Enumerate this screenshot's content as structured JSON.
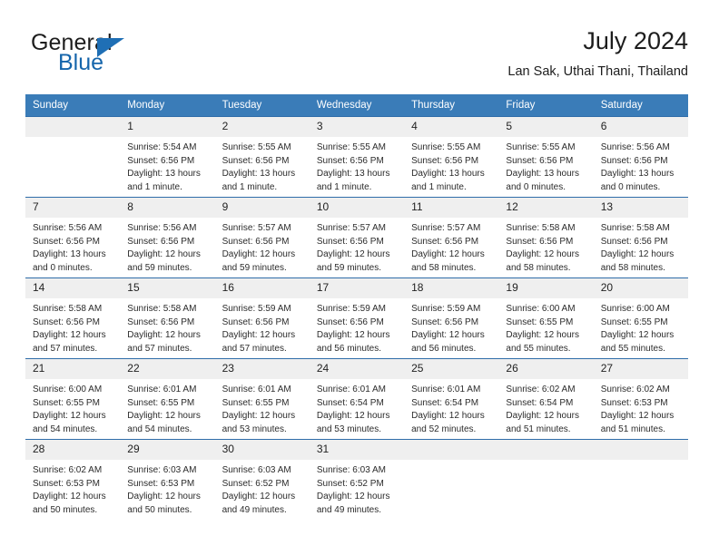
{
  "brand": {
    "name_part1": "General",
    "name_part2": "Blue",
    "triangle_icon": "triangle-icon"
  },
  "header": {
    "title": "July 2024",
    "subtitle": "Lan Sak, Uthai Thani, Thailand"
  },
  "colors": {
    "header_blue": "#3a7cb8",
    "row_border_blue": "#2f6da9",
    "daynum_band": "#efefef",
    "brand_blue": "#1565ab"
  },
  "weekday_headers": [
    "Sunday",
    "Monday",
    "Tuesday",
    "Wednesday",
    "Thursday",
    "Friday",
    "Saturday"
  ],
  "weeks": [
    [
      {
        "day": "",
        "empty": true,
        "sunrise": "",
        "sunset": "",
        "daylight1": "",
        "daylight2": ""
      },
      {
        "day": "1",
        "sunrise": "Sunrise: 5:54 AM",
        "sunset": "Sunset: 6:56 PM",
        "daylight1": "Daylight: 13 hours",
        "daylight2": "and 1 minute."
      },
      {
        "day": "2",
        "sunrise": "Sunrise: 5:55 AM",
        "sunset": "Sunset: 6:56 PM",
        "daylight1": "Daylight: 13 hours",
        "daylight2": "and 1 minute."
      },
      {
        "day": "3",
        "sunrise": "Sunrise: 5:55 AM",
        "sunset": "Sunset: 6:56 PM",
        "daylight1": "Daylight: 13 hours",
        "daylight2": "and 1 minute."
      },
      {
        "day": "4",
        "sunrise": "Sunrise: 5:55 AM",
        "sunset": "Sunset: 6:56 PM",
        "daylight1": "Daylight: 13 hours",
        "daylight2": "and 1 minute."
      },
      {
        "day": "5",
        "sunrise": "Sunrise: 5:55 AM",
        "sunset": "Sunset: 6:56 PM",
        "daylight1": "Daylight: 13 hours",
        "daylight2": "and 0 minutes."
      },
      {
        "day": "6",
        "sunrise": "Sunrise: 5:56 AM",
        "sunset": "Sunset: 6:56 PM",
        "daylight1": "Daylight: 13 hours",
        "daylight2": "and 0 minutes."
      }
    ],
    [
      {
        "day": "7",
        "sunrise": "Sunrise: 5:56 AM",
        "sunset": "Sunset: 6:56 PM",
        "daylight1": "Daylight: 13 hours",
        "daylight2": "and 0 minutes."
      },
      {
        "day": "8",
        "sunrise": "Sunrise: 5:56 AM",
        "sunset": "Sunset: 6:56 PM",
        "daylight1": "Daylight: 12 hours",
        "daylight2": "and 59 minutes."
      },
      {
        "day": "9",
        "sunrise": "Sunrise: 5:57 AM",
        "sunset": "Sunset: 6:56 PM",
        "daylight1": "Daylight: 12 hours",
        "daylight2": "and 59 minutes."
      },
      {
        "day": "10",
        "sunrise": "Sunrise: 5:57 AM",
        "sunset": "Sunset: 6:56 PM",
        "daylight1": "Daylight: 12 hours",
        "daylight2": "and 59 minutes."
      },
      {
        "day": "11",
        "sunrise": "Sunrise: 5:57 AM",
        "sunset": "Sunset: 6:56 PM",
        "daylight1": "Daylight: 12 hours",
        "daylight2": "and 58 minutes."
      },
      {
        "day": "12",
        "sunrise": "Sunrise: 5:58 AM",
        "sunset": "Sunset: 6:56 PM",
        "daylight1": "Daylight: 12 hours",
        "daylight2": "and 58 minutes."
      },
      {
        "day": "13",
        "sunrise": "Sunrise: 5:58 AM",
        "sunset": "Sunset: 6:56 PM",
        "daylight1": "Daylight: 12 hours",
        "daylight2": "and 58 minutes."
      }
    ],
    [
      {
        "day": "14",
        "sunrise": "Sunrise: 5:58 AM",
        "sunset": "Sunset: 6:56 PM",
        "daylight1": "Daylight: 12 hours",
        "daylight2": "and 57 minutes."
      },
      {
        "day": "15",
        "sunrise": "Sunrise: 5:58 AM",
        "sunset": "Sunset: 6:56 PM",
        "daylight1": "Daylight: 12 hours",
        "daylight2": "and 57 minutes."
      },
      {
        "day": "16",
        "sunrise": "Sunrise: 5:59 AM",
        "sunset": "Sunset: 6:56 PM",
        "daylight1": "Daylight: 12 hours",
        "daylight2": "and 57 minutes."
      },
      {
        "day": "17",
        "sunrise": "Sunrise: 5:59 AM",
        "sunset": "Sunset: 6:56 PM",
        "daylight1": "Daylight: 12 hours",
        "daylight2": "and 56 minutes."
      },
      {
        "day": "18",
        "sunrise": "Sunrise: 5:59 AM",
        "sunset": "Sunset: 6:56 PM",
        "daylight1": "Daylight: 12 hours",
        "daylight2": "and 56 minutes."
      },
      {
        "day": "19",
        "sunrise": "Sunrise: 6:00 AM",
        "sunset": "Sunset: 6:55 PM",
        "daylight1": "Daylight: 12 hours",
        "daylight2": "and 55 minutes."
      },
      {
        "day": "20",
        "sunrise": "Sunrise: 6:00 AM",
        "sunset": "Sunset: 6:55 PM",
        "daylight1": "Daylight: 12 hours",
        "daylight2": "and 55 minutes."
      }
    ],
    [
      {
        "day": "21",
        "sunrise": "Sunrise: 6:00 AM",
        "sunset": "Sunset: 6:55 PM",
        "daylight1": "Daylight: 12 hours",
        "daylight2": "and 54 minutes."
      },
      {
        "day": "22",
        "sunrise": "Sunrise: 6:01 AM",
        "sunset": "Sunset: 6:55 PM",
        "daylight1": "Daylight: 12 hours",
        "daylight2": "and 54 minutes."
      },
      {
        "day": "23",
        "sunrise": "Sunrise: 6:01 AM",
        "sunset": "Sunset: 6:55 PM",
        "daylight1": "Daylight: 12 hours",
        "daylight2": "and 53 minutes."
      },
      {
        "day": "24",
        "sunrise": "Sunrise: 6:01 AM",
        "sunset": "Sunset: 6:54 PM",
        "daylight1": "Daylight: 12 hours",
        "daylight2": "and 53 minutes."
      },
      {
        "day": "25",
        "sunrise": "Sunrise: 6:01 AM",
        "sunset": "Sunset: 6:54 PM",
        "daylight1": "Daylight: 12 hours",
        "daylight2": "and 52 minutes."
      },
      {
        "day": "26",
        "sunrise": "Sunrise: 6:02 AM",
        "sunset": "Sunset: 6:54 PM",
        "daylight1": "Daylight: 12 hours",
        "daylight2": "and 51 minutes."
      },
      {
        "day": "27",
        "sunrise": "Sunrise: 6:02 AM",
        "sunset": "Sunset: 6:53 PM",
        "daylight1": "Daylight: 12 hours",
        "daylight2": "and 51 minutes."
      }
    ],
    [
      {
        "day": "28",
        "sunrise": "Sunrise: 6:02 AM",
        "sunset": "Sunset: 6:53 PM",
        "daylight1": "Daylight: 12 hours",
        "daylight2": "and 50 minutes."
      },
      {
        "day": "29",
        "sunrise": "Sunrise: 6:03 AM",
        "sunset": "Sunset: 6:53 PM",
        "daylight1": "Daylight: 12 hours",
        "daylight2": "and 50 minutes."
      },
      {
        "day": "30",
        "sunrise": "Sunrise: 6:03 AM",
        "sunset": "Sunset: 6:52 PM",
        "daylight1": "Daylight: 12 hours",
        "daylight2": "and 49 minutes."
      },
      {
        "day": "31",
        "sunrise": "Sunrise: 6:03 AM",
        "sunset": "Sunset: 6:52 PM",
        "daylight1": "Daylight: 12 hours",
        "daylight2": "and 49 minutes."
      },
      {
        "day": "",
        "empty": true,
        "sunrise": "",
        "sunset": "",
        "daylight1": "",
        "daylight2": ""
      },
      {
        "day": "",
        "empty": true,
        "sunrise": "",
        "sunset": "",
        "daylight1": "",
        "daylight2": ""
      },
      {
        "day": "",
        "empty": true,
        "sunrise": "",
        "sunset": "",
        "daylight1": "",
        "daylight2": ""
      }
    ]
  ]
}
